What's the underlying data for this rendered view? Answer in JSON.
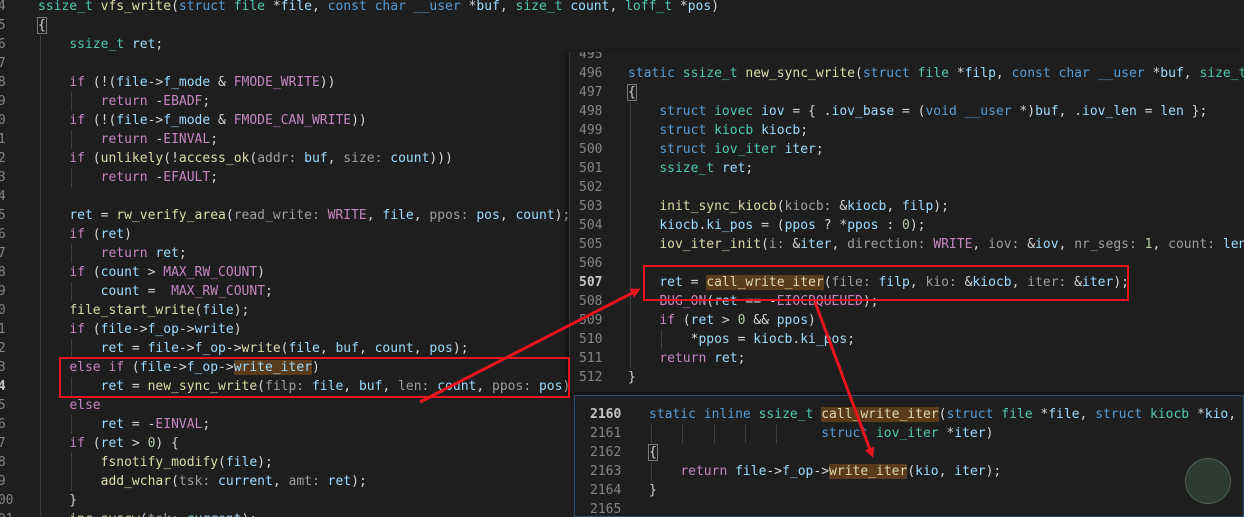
{
  "vfs_write": {
    "lines": [
      {
        "n": "74",
        "t": "<span class=\"ty\">ssize_t</span> <span class=\"fn\">vfs_write</span>(<span class=\"kw\">struct</span> <span class=\"ty\">file</span> *<span class=\"va\">file</span>, <span class=\"kw\">const</span> <span class=\"kw\">char</span> <span class=\"kw\">__user</span> *<span class=\"va\">buf</span>, <span class=\"ty\">size_t</span> <span class=\"va\">count</span>, <span class=\"ty\">loff_t</span> *<span class=\"va\">pos</span>)",
        "g": 0
      },
      {
        "n": "75",
        "t": "<span class=\"br\">{</span>",
        "g": 0
      },
      {
        "n": "76",
        "t": "    <span class=\"ty\">ssize_t</span> <span class=\"va\">ret</span>;",
        "g": 1
      },
      {
        "n": "77",
        "t": "",
        "g": 1
      },
      {
        "n": "78",
        "t": "    <span class=\"mac\">if</span> (!(<span class=\"va\">file</span>-><span class=\"va\">f_mode</span> & <span class=\"mac\">FMODE_WRITE</span>))",
        "g": 1
      },
      {
        "n": "79",
        "t": "        <span class=\"mac\">return</span> -<span class=\"mac\">EBADF</span>;",
        "g": 2
      },
      {
        "n": "80",
        "t": "    <span class=\"mac\">if</span> (!(<span class=\"va\">file</span>-><span class=\"va\">f_mode</span> & <span class=\"mac\">FMODE_CAN_WRITE</span>))",
        "g": 1
      },
      {
        "n": "81",
        "t": "        <span class=\"mac\">return</span> -<span class=\"mac\">EINVAL</span>;",
        "g": 2
      },
      {
        "n": "82",
        "t": "    <span class=\"mac\">if</span> (<span class=\"fn\">unlikely</span>(!<span class=\"fn\">access_ok</span>(<span class=\"ph\">addr:</span> <span class=\"va\">buf</span>, <span class=\"ph\">size:</span> <span class=\"va\">count</span>)))",
        "g": 1
      },
      {
        "n": "83",
        "t": "        <span class=\"mac\">return</span> -<span class=\"mac\">EFAULT</span>;",
        "g": 2
      },
      {
        "n": "84",
        "t": "",
        "g": 1
      },
      {
        "n": "85",
        "t": "    <span class=\"va\">ret</span> = <span class=\"fn\">rw_verify_area</span>(<span class=\"ph\">read_write:</span> <span class=\"mac\">WRITE</span>, <span class=\"va\">file</span>, <span class=\"ph\">ppos:</span> <span class=\"va\">pos</span>, <span class=\"va\">count</span>);",
        "g": 1
      },
      {
        "n": "86",
        "t": "    <span class=\"mac\">if</span> (<span class=\"va\">ret</span>)",
        "g": 1
      },
      {
        "n": "87",
        "t": "        <span class=\"mac\">return</span> <span class=\"va\">ret</span>;",
        "g": 2
      },
      {
        "n": "88",
        "t": "    <span class=\"mac\">if</span> (<span class=\"va\">count</span> > <span class=\"mac\">MAX_RW_COUNT</span>)",
        "g": 1
      },
      {
        "n": "89",
        "t": "        <span class=\"va\">count</span> =  <span class=\"mac\">MAX_RW_COUNT</span>;",
        "g": 2
      },
      {
        "n": "90",
        "t": "    <span class=\"fn\">file_start_write</span>(<span class=\"va\">file</span>);",
        "g": 1
      },
      {
        "n": "91",
        "t": "    <span class=\"mac\">if</span> (<span class=\"va\">file</span>-><span class=\"va\">f_op</span>-><span class=\"va\">write</span>)",
        "g": 1
      },
      {
        "n": "92",
        "t": "        <span class=\"va\">ret</span> = <span class=\"va\">file</span>-><span class=\"va\">f_op</span>-><span class=\"fn\">write</span>(<span class=\"va\">file</span>, <span class=\"va\">buf</span>, <span class=\"va\">count</span>, <span class=\"va\">pos</span>);",
        "g": 2
      },
      {
        "n": "93",
        "t": "    <span class=\"mac\">else if</span> (<span class=\"va\">file</span>-><span class=\"va\">f_op</span>-><span class=\"va ref\">write_iter</span>)",
        "g": 1
      },
      {
        "n": "94",
        "t": "        <span class=\"va\">ret</span> = <span class=\"fn\">new_sync_write</span>(<span class=\"ph\">filp:</span> <span class=\"va\">file</span>, <span class=\"va\">buf</span>, <span class=\"ph\">len:</span> <span class=\"va\">count</span>, <span class=\"ph\">ppos:</span> <span class=\"va\">pos</span>);",
        "g": 2,
        "cur": true
      },
      {
        "n": "95",
        "t": "    <span class=\"mac\">else</span>",
        "g": 1
      },
      {
        "n": "96",
        "t": "        <span class=\"va\">ret</span> = -<span class=\"mac\">EINVAL</span>;",
        "g": 2
      },
      {
        "n": "97",
        "t": "    <span class=\"mac\">if</span> (<span class=\"va\">ret</span> > <span class=\"nu\">0</span>) {",
        "g": 1
      },
      {
        "n": "98",
        "t": "        <span class=\"fn\">fsnotify_modify</span>(<span class=\"va\">file</span>);",
        "g": 2
      },
      {
        "n": "99",
        "t": "        <span class=\"fn\">add_wchar</span>(<span class=\"ph\">tsk:</span> <span class=\"va\">current</span>, <span class=\"ph\">amt:</span> <span class=\"va\">ret</span>);",
        "g": 2
      },
      {
        "n": "100",
        "t": "    }",
        "g": 1
      },
      {
        "n": "101",
        "t": "    <span class=\"fn\">inc_syscw</span>(<span class=\"ph\">tsk:</span> <span class=\"va\">current</span>);",
        "g": 1
      }
    ]
  },
  "new_sync_write": {
    "lines": [
      {
        "n": "495",
        "t": "",
        "g": 0
      },
      {
        "n": "496",
        "t": "<span class=\"kw\">static</span> <span class=\"ty\">ssize_t</span> <span class=\"fn\">new_sync_write</span>(<span class=\"kw\">struct</span> <span class=\"ty\">file</span> *<span class=\"va\">filp</span>, <span class=\"kw\">const</span> <span class=\"kw\">char</span> <span class=\"kw\">__user</span> *<span class=\"va\">buf</span>, <span class=\"ty\">size_t</span> <span class=\"va\">len</span>, <span class=\"ty\">loff_t</span> *<span class=\"va\">ppos</span>)",
        "g": 0
      },
      {
        "n": "497",
        "t": "<span class=\"br\">{</span>",
        "g": 0
      },
      {
        "n": "498",
        "t": "    <span class=\"kw\">struct</span> <span class=\"ty\">iovec</span> <span class=\"va\">iov</span> = { .<span class=\"va\">iov_base</span> = (<span class=\"kw\">void</span> <span class=\"kw\">__user</span> *)<span class=\"va\">buf</span>, .<span class=\"va\">iov_len</span> = <span class=\"va\">len</span> };",
        "g": 1
      },
      {
        "n": "499",
        "t": "    <span class=\"kw\">struct</span> <span class=\"ty\">kiocb</span> <span class=\"va\">kiocb</span>;",
        "g": 1
      },
      {
        "n": "500",
        "t": "    <span class=\"kw\">struct</span> <span class=\"ty\">iov_iter</span> <span class=\"va\">iter</span>;",
        "g": 1
      },
      {
        "n": "501",
        "t": "    <span class=\"ty\">ssize_t</span> <span class=\"va\">ret</span>;",
        "g": 1
      },
      {
        "n": "502",
        "t": "",
        "g": 1
      },
      {
        "n": "503",
        "t": "    <span class=\"fn\">init_sync_kiocb</span>(<span class=\"ph\">kiocb:</span> &<span class=\"va\">kiocb</span>, <span class=\"va\">filp</span>);",
        "g": 1
      },
      {
        "n": "504",
        "t": "    <span class=\"va\">kiocb</span>.<span class=\"va\">ki_pos</span> = (<span class=\"va\">ppos</span> ? *<span class=\"va\">ppos</span> : <span class=\"nu\">0</span>);",
        "g": 1
      },
      {
        "n": "505",
        "t": "    <span class=\"fn\">iov_iter_init</span>(<span class=\"ph\">i:</span> &<span class=\"va\">iter</span>, <span class=\"ph\">direction:</span> <span class=\"mac\">WRITE</span>, <span class=\"ph\">iov:</span> &<span class=\"va\">iov</span>, <span class=\"ph\">nr_segs:</span> <span class=\"nu\">1</span>, <span class=\"ph\">count:</span> <span class=\"va\">len</span>);",
        "g": 1
      },
      {
        "n": "506",
        "t": "",
        "g": 1
      },
      {
        "n": "507",
        "t": "    <span class=\"va\">ret</span> = <span class=\"fn ref\">call_write_iter</span>(<span class=\"ph\">file:</span> <span class=\"va\">filp</span>, <span class=\"ph\">kio:</span> &<span class=\"va\">kiocb</span>, <span class=\"ph\">iter:</span> &<span class=\"va\">iter</span>);",
        "g": 1,
        "cur": true
      },
      {
        "n": "508",
        "t": "    <span class=\"mac\">BUG_ON</span>(<span class=\"va\">ret</span> == -<span class=\"mac\">EIOCBQUEUED</span>);",
        "g": 1
      },
      {
        "n": "509",
        "t": "    <span class=\"mac\">if</span> (<span class=\"va\">ret</span> > <span class=\"nu\">0</span> && <span class=\"va\">ppos</span>)",
        "g": 1
      },
      {
        "n": "510",
        "t": "        *<span class=\"va\">ppos</span> = <span class=\"va\">kiocb</span>.<span class=\"va\">ki_pos</span>;",
        "g": 2
      },
      {
        "n": "511",
        "t": "    <span class=\"mac\">return</span> <span class=\"va\">ret</span>;",
        "g": 1
      },
      {
        "n": "512",
        "t": "}",
        "g": 0
      }
    ]
  },
  "call_write_iter": {
    "lines": [
      {
        "n": "2160",
        "t": "<span class=\"kw\">static</span> <span class=\"kw\">inline</span> <span class=\"ty\">ssize_t</span> <span class=\"fn ref\">call_write_iter</span>(<span class=\"kw\">struct</span> <span class=\"ty\">file</span> *<span class=\"va\">file</span>, <span class=\"kw\">struct</span> <span class=\"ty\">kiocb</span> *<span class=\"va\">kio</span>,",
        "g": 0,
        "cur": true
      },
      {
        "n": "2161",
        "t": "                      <span class=\"kw\">struct</span> <span class=\"ty\">iov_iter</span> *<span class=\"va\">iter</span>)",
        "g": 5
      },
      {
        "n": "2162",
        "t": "<span class=\"br\">{</span>",
        "g": 0
      },
      {
        "n": "2163",
        "t": "    <span class=\"mac\">return</span> <span class=\"va\">file</span>-><span class=\"va\">f_op</span>-><span class=\"fn ref\">write_iter</span>(<span class=\"va\">kio</span>, <span class=\"va\">iter</span>);",
        "g": 1
      },
      {
        "n": "2164",
        "t": "}",
        "g": 0
      },
      {
        "n": "2165",
        "t": "",
        "g": 0
      }
    ]
  },
  "colors": {
    "annotation_red": "#e8141e",
    "background": "#1e1e1e"
  }
}
